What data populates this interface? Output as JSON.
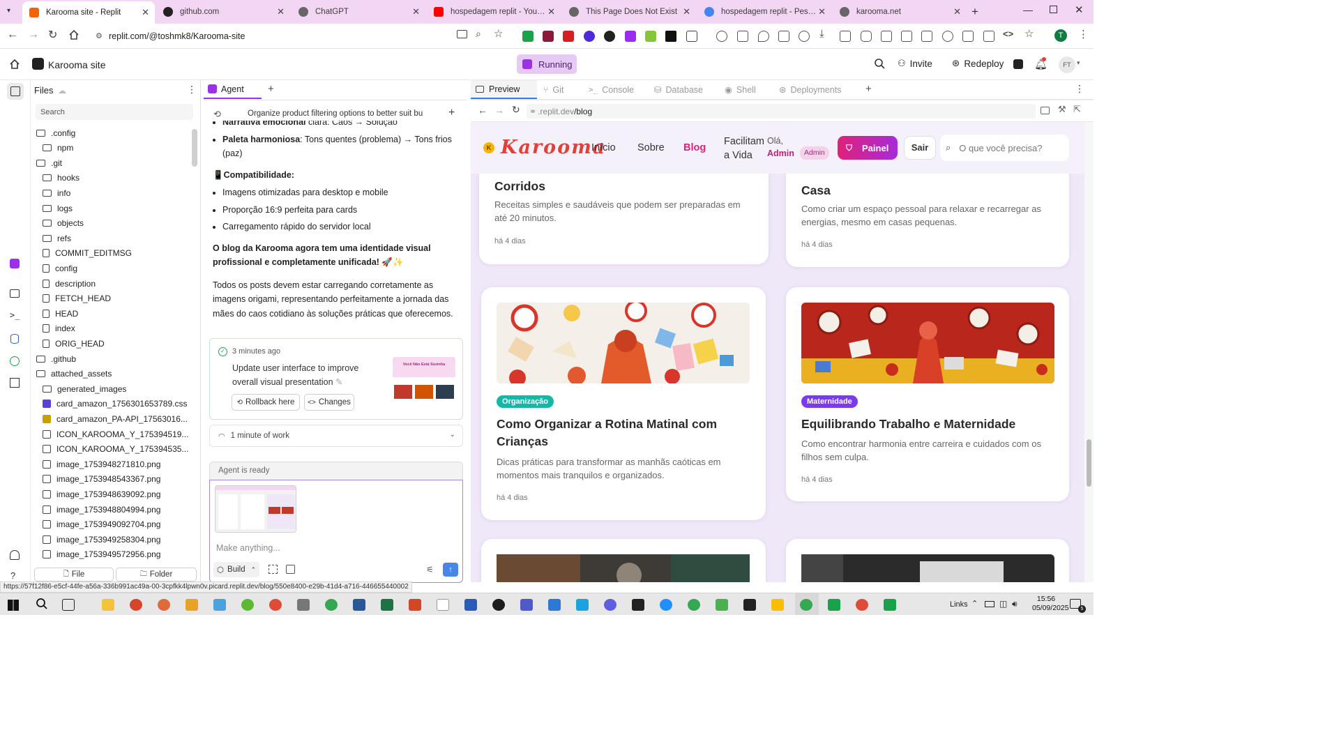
{
  "browser": {
    "tabs": [
      {
        "title": "Karooma site - Replit",
        "color": "#f26207",
        "active": true
      },
      {
        "title": "github.com",
        "color": "#222222"
      },
      {
        "title": "ChatGPT",
        "color": "#444444"
      },
      {
        "title": "hospedagem replit - YouTube",
        "color": "#ff0000"
      },
      {
        "title": "This Page Does Not Exist",
        "color": "#555555"
      },
      {
        "title": "hospedagem replit - Pesquisa Google",
        "color": "#4285f4"
      },
      {
        "title": "karooma.net",
        "color": "#555555"
      }
    ],
    "url": "replit.com/@toshmk8/Karooma-site",
    "profile_initial": "T"
  },
  "replit": {
    "project_name": "Karooma site",
    "run_label": "Running",
    "invite_label": "Invite",
    "redeploy_label": "Redeploy",
    "user_initials": "FT"
  },
  "files": {
    "header": "Files",
    "search_placeholder": "Search",
    "items": [
      {
        "name": ".config",
        "type": "folder",
        "indent": 0
      },
      {
        "name": "npm",
        "type": "folder",
        "indent": 1
      },
      {
        "name": ".git",
        "type": "folder",
        "indent": 0
      },
      {
        "name": "hooks",
        "type": "folder",
        "indent": 1
      },
      {
        "name": "info",
        "type": "folder",
        "indent": 1
      },
      {
        "name": "logs",
        "type": "folder",
        "indent": 1
      },
      {
        "name": "objects",
        "type": "folder",
        "indent": 1
      },
      {
        "name": "refs",
        "type": "folder",
        "indent": 1
      },
      {
        "name": "COMMIT_EDITMSG",
        "type": "file",
        "indent": 1
      },
      {
        "name": "config",
        "type": "file",
        "indent": 1
      },
      {
        "name": "description",
        "type": "file",
        "indent": 1
      },
      {
        "name": "FETCH_HEAD",
        "type": "file",
        "indent": 1
      },
      {
        "name": "HEAD",
        "type": "file",
        "indent": 1
      },
      {
        "name": "index",
        "type": "file",
        "indent": 1
      },
      {
        "name": "ORIG_HEAD",
        "type": "file",
        "indent": 1
      },
      {
        "name": ".github",
        "type": "folder",
        "indent": 0
      },
      {
        "name": "attached_assets",
        "type": "folder",
        "indent": 0
      },
      {
        "name": "generated_images",
        "type": "folder",
        "indent": 1
      },
      {
        "name": "card_amazon_1756301653789.css",
        "type": "css",
        "indent": 1
      },
      {
        "name": "card_amazon_PA-API_17563016...",
        "type": "js",
        "indent": 1
      },
      {
        "name": "ICON_KAROOMA_Y_175394519...",
        "type": "image",
        "indent": 1
      },
      {
        "name": "ICON_KAROOMA_Y_175394535...",
        "type": "image",
        "indent": 1
      },
      {
        "name": "image_1753948271810.png",
        "type": "image",
        "indent": 1
      },
      {
        "name": "image_1753948543367.png",
        "type": "image",
        "indent": 1
      },
      {
        "name": "image_1753948639092.png",
        "type": "image",
        "indent": 1
      },
      {
        "name": "image_1753948804994.png",
        "type": "image",
        "indent": 1
      },
      {
        "name": "image_1753949092704.png",
        "type": "image",
        "indent": 1
      },
      {
        "name": "image_1753949258304.png",
        "type": "image",
        "indent": 1
      },
      {
        "name": "image_1753949572956.png",
        "type": "image",
        "indent": 1
      }
    ],
    "new_file_label": "File",
    "new_folder_label": "Folder"
  },
  "agent": {
    "tab_label": "Agent",
    "thread_title": "Organize product filtering options to better suit bu...",
    "msg": {
      "li1_bold": "Narrativa emocional",
      "li1_rest": " clara: Caos → Solução",
      "li2_bold": "Paleta harmoniosa",
      "li2_rest": ": Tons quentes (problema) → Tons frios (paz)",
      "compat_heading": "📱Compatibilidade:",
      "compat_items": [
        "Imagens otimizadas para desktop e mobile",
        "Proporção 16:9 perfeita para cards",
        "Carregamento rápido do servidor local"
      ],
      "summary_bold": "O blog da Karooma agora tem uma identidade visual profissional e completamente unificada! 🚀✨",
      "summary_text": "Todos os posts devem estar carregando corretamente as imagens origami, representando perfeitamente a jornada das mães do caos cotidiano às soluções práticas que oferecemos."
    },
    "checkpoint": {
      "time": "3 minutes ago",
      "text": "Update user interface to improve overall visual presentation",
      "rollback_label": "Rollback here",
      "changes_label": "Changes",
      "thumb_text": "Você Não Está Sozinha"
    },
    "work_label": "1 minute of work",
    "ready_label": "Agent is ready",
    "input_placeholder": "Make anything...",
    "build_label": "Build"
  },
  "workspace_tabs": [
    {
      "label": "Preview",
      "active": true
    },
    {
      "label": "Git"
    },
    {
      "label": "Console"
    },
    {
      "label": "Database"
    },
    {
      "label": "Shell"
    },
    {
      "label": "Deployments"
    }
  ],
  "preview": {
    "url_host": ".replit.dev",
    "url_path": "/blog",
    "site": {
      "logo_text": "Karooma",
      "nav": [
        "Início",
        "Sobre",
        "Blog",
        "Facilitam a Vida"
      ],
      "active_nav": "Blog",
      "greeting": "Olá,",
      "user": "Admin",
      "admin_badge": "Admin",
      "painel_label": "Painel",
      "sair_label": "Sair",
      "search_placeholder": "O que você precisa?"
    },
    "top_cards": [
      {
        "title_line": "Corridos",
        "desc": "Receitas simples e saudáveis que podem ser preparadas em até 20 minutos.",
        "date": "há 4 dias"
      },
      {
        "title_line": "Casa",
        "desc": "Como criar um espaço pessoal para relaxar e recarregar as energias, mesmo em casas pequenas.",
        "date": "há 4 dias"
      }
    ],
    "cards": [
      {
        "badge": "Organização",
        "badge_color": "#14b8a6",
        "title": "Como Organizar a Rotina Matinal com Crianças",
        "desc": "Dicas práticas para transformar as manhãs caóticas em momentos mais tranquilos e organizados.",
        "date": "há 4 dias"
      },
      {
        "badge": "Maternidade",
        "badge_color": "#7c3aed",
        "title": "Equilibrando Trabalho e Maternidade",
        "desc": "Como encontrar harmonia entre carreira e cuidados com os filhos sem culpa.",
        "date": "há 4 dias"
      }
    ]
  },
  "status_url": "https://57f12f86-e5cf-44fe-a56a-336b991ac49a-00-3cpfkk4lpwn0v.picard.replit.dev/blog/550e8400-e29b-41d4-a716-446655440002",
  "taskbar": {
    "links_label": "Links",
    "time": "15:56",
    "date": "05/09/2025",
    "notif_count": "5"
  }
}
